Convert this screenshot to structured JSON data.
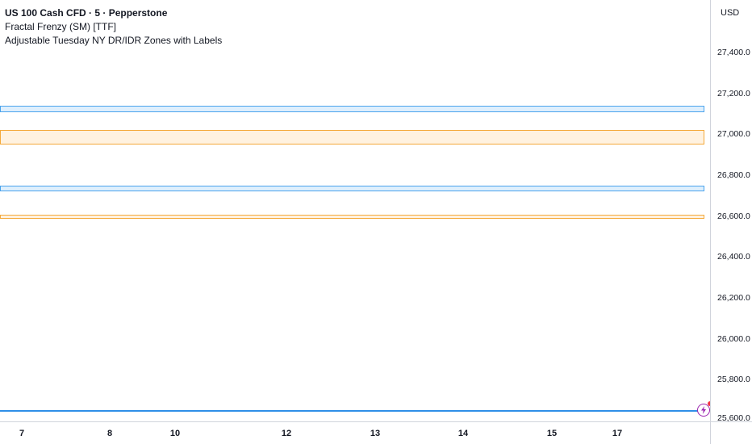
{
  "legend": {
    "title": "US 100 Cash CFD · 5 · Pepperstone",
    "indicator_1": "Fractal Frenzy (SM) [TTF]",
    "indicator_2": "Adjustable Tuesday NY DR/IDR Zones with Labels"
  },
  "price_scale": {
    "currency": "USD",
    "ticks": [
      "27,400.0",
      "27,200.0",
      "27,000.0",
      "26,800.0",
      "26,600.0",
      "26,400.0",
      "26,200.0",
      "26,000.0",
      "25,800.0",
      "25,600.0"
    ]
  },
  "time_axis": {
    "ticks": [
      "7",
      "8",
      "10",
      "12",
      "13",
      "14",
      "15",
      "17"
    ]
  },
  "colors": {
    "zone_blue": "#4aa3ec",
    "zone_orange": "#f4a93a",
    "line_blue": "#2f8fe8",
    "flash_icon": "#9c27b0"
  },
  "icons": {
    "flash": "lightning-icon"
  }
}
